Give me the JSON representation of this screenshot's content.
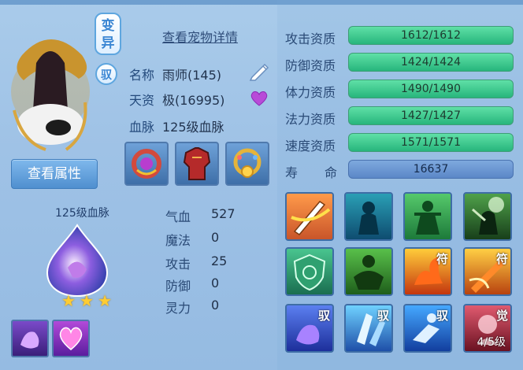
{
  "pet": {
    "variant_badge": "变异",
    "tame_badge": "驭",
    "view_attributes_button": "查看属性",
    "view_pet_details_link": "查看宠物详情",
    "name_label": "名称",
    "name_value": "雨师(145)",
    "aptitude_label": "天资",
    "aptitude_value": "极(16995)",
    "bloodline_label": "血脉",
    "bloodline_value": "125级血脉"
  },
  "bloodline_panel": {
    "title": "125级血脉",
    "stars": 3
  },
  "stats": [
    {
      "label": "气血",
      "value": "527"
    },
    {
      "label": "魔法",
      "value": "0"
    },
    {
      "label": "攻击",
      "value": "25"
    },
    {
      "label": "防御",
      "value": "0"
    },
    {
      "label": "灵力",
      "value": "0"
    }
  ],
  "qualities": [
    {
      "label": "攻击资质",
      "value": "1612/1612"
    },
    {
      "label": "防御资质",
      "value": "1424/1424"
    },
    {
      "label": "体力资质",
      "value": "1490/1490"
    },
    {
      "label": "法力资质",
      "value": "1427/1427"
    },
    {
      "label": "速度资质",
      "value": "1571/1571"
    }
  ],
  "life": {
    "label_1": "寿",
    "label_2": "命",
    "value": "16637"
  },
  "skill_tags": {
    "fu": "符",
    "yu": "驭",
    "jue": "觉",
    "level": "4/5级"
  },
  "colors": {
    "quality_bar": "#27b57c",
    "life_bar": "#5b87c7",
    "accent": "#3b86d3"
  }
}
